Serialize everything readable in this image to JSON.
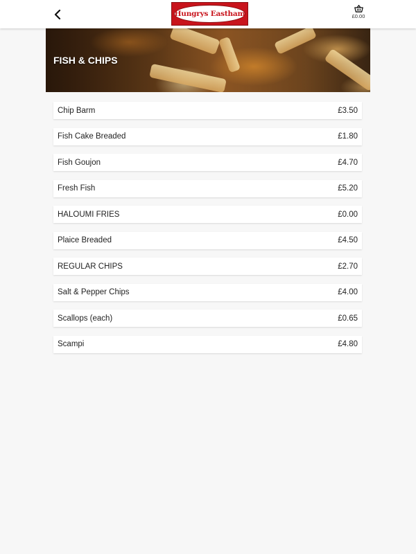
{
  "header": {
    "logo_text": "Hungrys Eastham",
    "basket_total": "£0.00",
    "icons": {
      "back": "chevron-left-icon",
      "basket": "basket-icon"
    },
    "colors": {
      "logo_red": "#c8141c",
      "background": "#f7f7f7"
    }
  },
  "category": {
    "title": "FISH & CHIPS"
  },
  "menu": {
    "items": [
      {
        "name": "Chip Barm",
        "price": "£3.50"
      },
      {
        "name": "Fish Cake Breaded",
        "price": "£1.80"
      },
      {
        "name": "Fish Goujon",
        "price": "£4.70"
      },
      {
        "name": "Fresh Fish",
        "price": "£5.20"
      },
      {
        "name": "HALOUMI FRIES",
        "price": "£0.00"
      },
      {
        "name": "Plaice Breaded",
        "price": "£4.50"
      },
      {
        "name": "REGULAR CHIPS",
        "price": "£2.70"
      },
      {
        "name": "Salt & Pepper Chips",
        "price": "£4.00"
      },
      {
        "name": "Scallops (each)",
        "price": "£0.65"
      },
      {
        "name": "Scampi",
        "price": "£4.80"
      }
    ]
  }
}
